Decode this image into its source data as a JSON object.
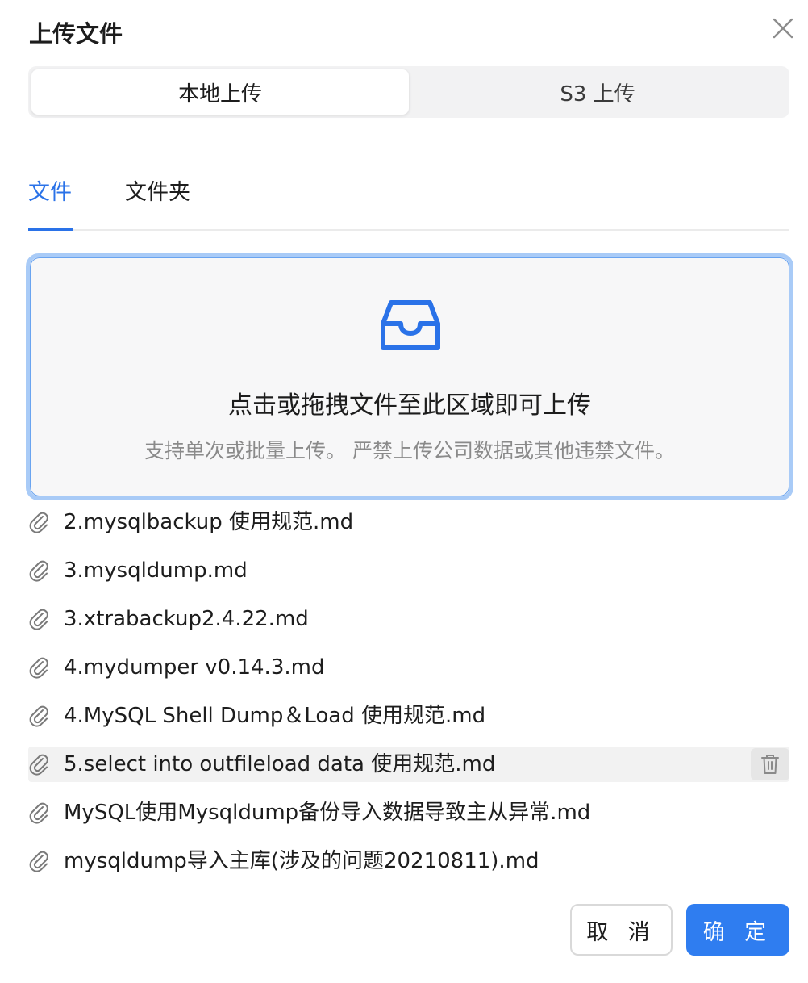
{
  "dialog": {
    "title": "上传文件",
    "close_icon": "close-icon"
  },
  "source_switch": {
    "options": [
      {
        "label": "本地上传",
        "selected": true
      },
      {
        "label": "S3 上传",
        "selected": false
      }
    ]
  },
  "tabs": [
    {
      "label": "文件",
      "active": true
    },
    {
      "label": "文件夹",
      "active": false
    }
  ],
  "dropzone": {
    "icon": "inbox-icon",
    "title": "点击或拖拽文件至此区域即可上传",
    "hint": "支持单次或批量上传。 严禁上传公司数据或其他违禁文件。"
  },
  "files": [
    {
      "name": "2.mysqlbackup 使用规范.md"
    },
    {
      "name": "3.mysqldump.md"
    },
    {
      "name": "3.xtrabackup2.4.22.md"
    },
    {
      "name": "4.mydumper v0.14.3.md"
    },
    {
      "name": "4.MySQL Shell Dump＆Load 使用规范.md"
    },
    {
      "name": "5.select into outfileload data 使用规范.md",
      "hovered": true
    },
    {
      "name": "MySQL使用Mysqldump备份导入数据导致主从异常.md"
    },
    {
      "name": "mysqldump导入主库(涉及的问题20210811).md"
    }
  ],
  "footer": {
    "cancel_label": "取 消",
    "ok_label": "确 定"
  },
  "colors": {
    "accent": "#2f7df0",
    "tab_active": "#2a72e8",
    "dropzone_border": "#a9cbf7"
  }
}
